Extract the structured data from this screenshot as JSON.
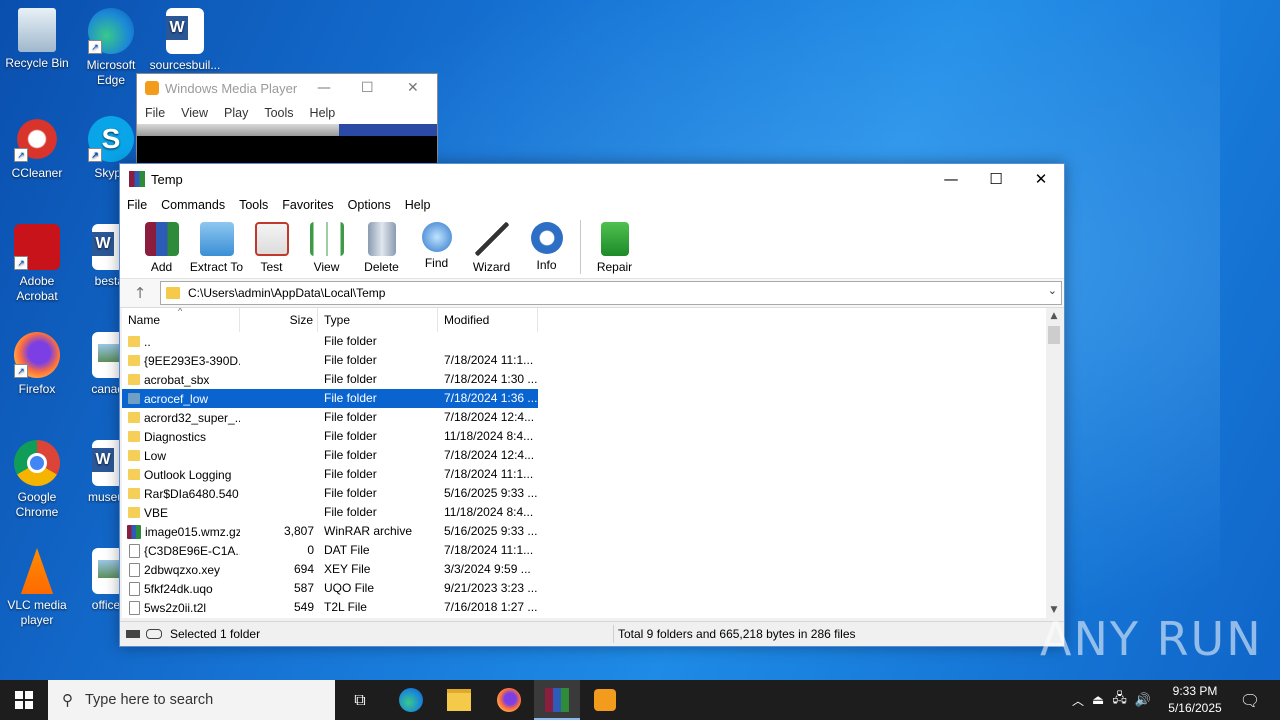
{
  "desktop": {
    "icons": [
      {
        "label": "Recycle Bin"
      },
      {
        "label": "Microsoft Edge"
      },
      {
        "label": "sourcesbuil..."
      },
      {
        "label": "CCleaner"
      },
      {
        "label": "Skype"
      },
      {
        "label": "Adobe Acrobat"
      },
      {
        "label": "bestat"
      },
      {
        "label": "Firefox"
      },
      {
        "label": "canada"
      },
      {
        "label": "Google Chrome"
      },
      {
        "label": "museum"
      },
      {
        "label": "VLC media player"
      },
      {
        "label": "officerfi"
      }
    ]
  },
  "wmp": {
    "title": "Windows Media Player",
    "menu": [
      "File",
      "View",
      "Play",
      "Tools",
      "Help"
    ]
  },
  "winrar": {
    "title": "Temp",
    "menu": [
      "File",
      "Commands",
      "Tools",
      "Favorites",
      "Options",
      "Help"
    ],
    "toolbar": [
      "Add",
      "Extract To",
      "Test",
      "View",
      "Delete",
      "Find",
      "Wizard",
      "Info",
      "Repair"
    ],
    "path": "C:\\Users\\admin\\AppData\\Local\\Temp",
    "columns": [
      "Name",
      "Size",
      "Type",
      "Modified"
    ],
    "rows": [
      {
        "name": "..",
        "size": "",
        "type": "File folder",
        "modified": "",
        "kind": "folder"
      },
      {
        "name": "{9EE293E3-390D...",
        "size": "",
        "type": "File folder",
        "modified": "7/18/2024 11:1...",
        "kind": "folder"
      },
      {
        "name": "acrobat_sbx",
        "size": "",
        "type": "File folder",
        "modified": "7/18/2024 1:30 ...",
        "kind": "folder"
      },
      {
        "name": "acrocef_low",
        "size": "",
        "type": "File folder",
        "modified": "7/18/2024 1:36 ...",
        "kind": "folder",
        "selected": true
      },
      {
        "name": "acrord32_super_...",
        "size": "",
        "type": "File folder",
        "modified": "7/18/2024 12:4...",
        "kind": "folder"
      },
      {
        "name": "Diagnostics",
        "size": "",
        "type": "File folder",
        "modified": "11/18/2024 8:4...",
        "kind": "folder"
      },
      {
        "name": "Low",
        "size": "",
        "type": "File folder",
        "modified": "7/18/2024 12:4...",
        "kind": "folder"
      },
      {
        "name": "Outlook Logging",
        "size": "",
        "type": "File folder",
        "modified": "7/18/2024 11:1...",
        "kind": "folder"
      },
      {
        "name": "Rar$DIa6480.540",
        "size": "",
        "type": "File folder",
        "modified": "5/16/2025 9:33 ...",
        "kind": "folder"
      },
      {
        "name": "VBE",
        "size": "",
        "type": "File folder",
        "modified": "11/18/2024 8:4...",
        "kind": "folder"
      },
      {
        "name": "image015.wmz.gz",
        "size": "3,807",
        "type": "WinRAR archive",
        "modified": "5/16/2025 9:33 ...",
        "kind": "rar"
      },
      {
        "name": "{C3D8E96E-C1A...",
        "size": "0",
        "type": "DAT File",
        "modified": "7/18/2024 11:1...",
        "kind": "file"
      },
      {
        "name": "2dbwqzxo.xey",
        "size": "694",
        "type": "XEY File",
        "modified": "3/3/2024 9:59 ...",
        "kind": "file"
      },
      {
        "name": "5fkf24dk.uqo",
        "size": "587",
        "type": "UQO File",
        "modified": "9/21/2023 3:23 ...",
        "kind": "file"
      },
      {
        "name": "5ws2z0ii.t2l",
        "size": "549",
        "type": "T2L File",
        "modified": "7/16/2018 1:27 ...",
        "kind": "file"
      }
    ],
    "status_left": "Selected 1 folder",
    "status_right": "Total 9 folders and 665,218 bytes in 286 files"
  },
  "watermark": "ANY RUN",
  "taskbar": {
    "search_placeholder": "Type here to search",
    "time": "9:33 PM",
    "date": "5/16/2025"
  }
}
